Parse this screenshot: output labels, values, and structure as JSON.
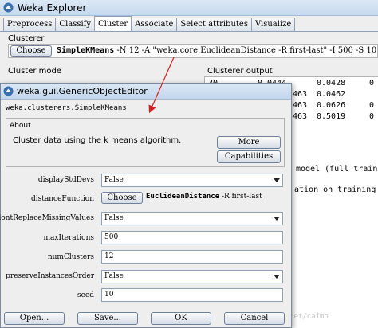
{
  "explorer": {
    "title": "Weka Explorer",
    "tabs": [
      "Preprocess",
      "Classify",
      "Cluster",
      "Associate",
      "Select attributes",
      "Visualize"
    ],
    "active_tab": "Cluster",
    "clusterer_label": "Clusterer",
    "choose_label": "Choose",
    "clusterer_name": "SimpleKMeans",
    "clusterer_options": " -N 12 -A \"weka.core.EuclideanDistance -R first-last\" -I 500 -S 10",
    "cluster_mode_label": "Cluster mode",
    "output_label": "Clusterer output",
    "output_rows": [
      [
        "30",
        "0.0444",
        "0.0428",
        "0"
      ],
      [
        "",
        "463",
        "0.0462",
        ""
      ],
      [
        "",
        "463",
        "0.0626",
        "0"
      ],
      [
        "",
        "463",
        "0.5019",
        "0"
      ]
    ],
    "output_text_1": "model (full traini",
    "output_text_2": "ation on training s",
    "watermark": "http://blog.csdn.net/caimo"
  },
  "dialog": {
    "title": "weka.gui.GenericObjectEditor",
    "class_name": "weka.clusterers.SimpleKMeans",
    "about_label": "About",
    "about_text": "Cluster data using the k means algorithm.",
    "more_label": "More",
    "capabilities_label": "Capabilities",
    "props": {
      "displayStdDevs": {
        "label": "displayStdDevs",
        "value": "False"
      },
      "distanceFunction": {
        "label": "distanceFunction",
        "choose": "Choose",
        "name": "EuclideanDistance",
        "options": " -R first-last"
      },
      "dontReplaceMissingValues": {
        "label": "dontReplaceMissingValues",
        "value": "False"
      },
      "maxIterations": {
        "label": "maxIterations",
        "value": "500"
      },
      "numClusters": {
        "label": "numClusters",
        "value": "12"
      },
      "preserveInstancesOrder": {
        "label": "preserveInstancesOrder",
        "value": "False"
      },
      "seed": {
        "label": "seed",
        "value": "10"
      }
    },
    "buttons": {
      "open": "Open...",
      "save": "Save...",
      "ok": "OK",
      "cancel": "Cancel"
    }
  },
  "colors": {
    "arrow": "#d42020",
    "title_bar": "#c6d9ee"
  },
  "icons": {
    "window_icon": "weka-bird-icon"
  }
}
